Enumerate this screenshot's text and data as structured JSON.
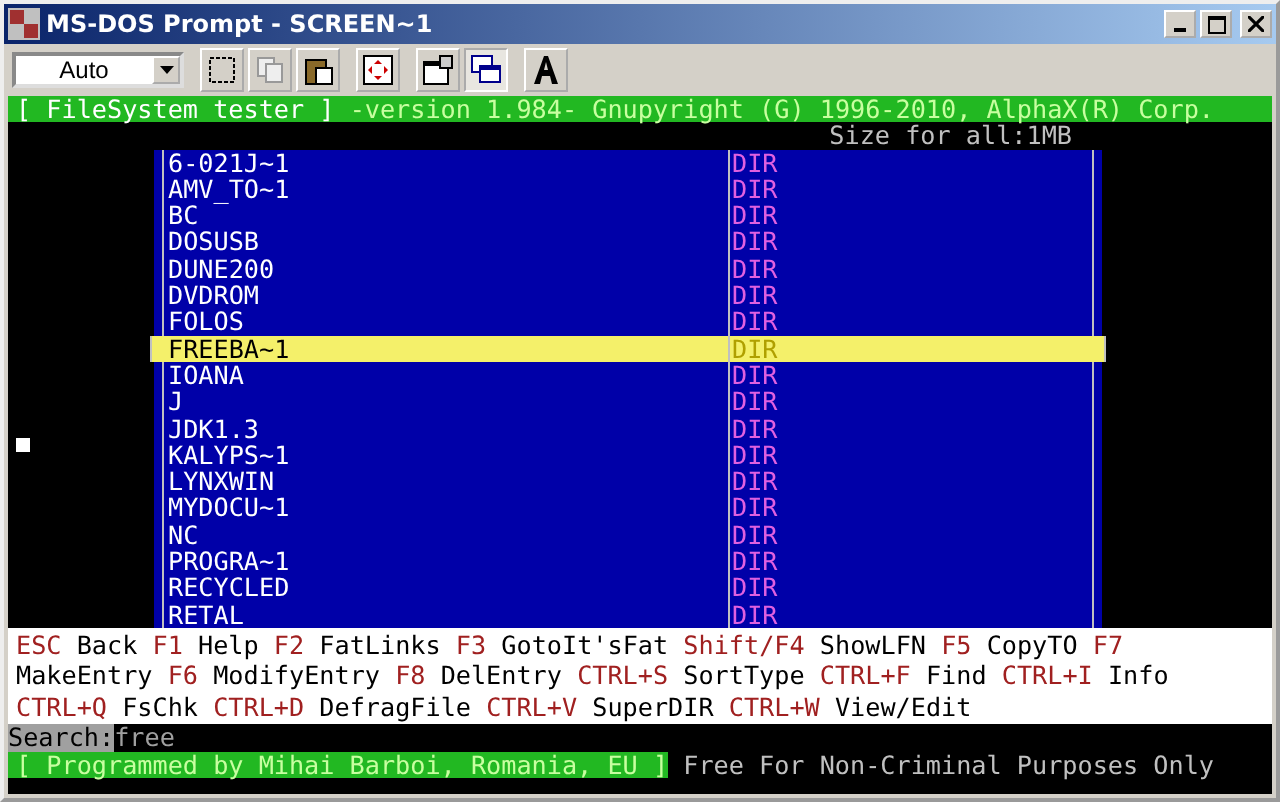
{
  "window": {
    "title": "MS-DOS Prompt - SCREEN~1"
  },
  "toolbar": {
    "font_size": "Auto"
  },
  "header": {
    "title": "[ FileSystem tester ]",
    "info": "-version 1.984- Gnupyright (G) 1996-2010, AlphaX(R) Corp.",
    "size": "Size for all:1MB"
  },
  "files": [
    {
      "name": "6-021J~1",
      "type": "DIR",
      "selected": false
    },
    {
      "name": "AMV_TO~1",
      "type": "DIR",
      "selected": false
    },
    {
      "name": "BC",
      "type": "DIR",
      "selected": false
    },
    {
      "name": "DOSUSB",
      "type": "DIR",
      "selected": false
    },
    {
      "name": "DUNE200",
      "type": "DIR",
      "selected": false
    },
    {
      "name": "DVDROM",
      "type": "DIR",
      "selected": false
    },
    {
      "name": "FOLOS",
      "type": "DIR",
      "selected": false
    },
    {
      "name": "FREEBA~1",
      "type": "DIR",
      "selected": true
    },
    {
      "name": "IOANA",
      "type": "DIR",
      "selected": false
    },
    {
      "name": "J",
      "type": "DIR",
      "selected": false
    },
    {
      "name": "JDK1.3",
      "type": "DIR",
      "selected": false
    },
    {
      "name": "KALYPS~1",
      "type": "DIR",
      "selected": false
    },
    {
      "name": "LYNXWIN",
      "type": "DIR",
      "selected": false
    },
    {
      "name": "MYDOCU~1",
      "type": "DIR",
      "selected": false
    },
    {
      "name": "NC",
      "type": "DIR",
      "selected": false
    },
    {
      "name": "PROGRA~1",
      "type": "DIR",
      "selected": false
    },
    {
      "name": "RECYCLED",
      "type": "DIR",
      "selected": false
    },
    {
      "name": "RETAL",
      "type": "DIR",
      "selected": false
    }
  ],
  "key_lines": [
    [
      {
        "kind": "key",
        "text": "ESC"
      },
      {
        "kind": "label",
        "text": "Back"
      },
      {
        "kind": "key",
        "text": "F1"
      },
      {
        "kind": "label",
        "text": "Help"
      },
      {
        "kind": "key",
        "text": "F2"
      },
      {
        "kind": "label",
        "text": "FatLinks"
      },
      {
        "kind": "key",
        "text": "F3"
      },
      {
        "kind": "label",
        "text": "GotoIt'sFat"
      },
      {
        "kind": "key",
        "text": "Shift/F4"
      },
      {
        "kind": "label",
        "text": "ShowLFN"
      },
      {
        "kind": "key",
        "text": "F5"
      },
      {
        "kind": "label",
        "text": "CopyTO"
      },
      {
        "kind": "key",
        "text": "F7"
      }
    ],
    [
      {
        "kind": "label",
        "text": "MakeEntry"
      },
      {
        "kind": "key",
        "text": "F6"
      },
      {
        "kind": "label",
        "text": "ModifyEntry"
      },
      {
        "kind": "key",
        "text": "F8"
      },
      {
        "kind": "label",
        "text": "DelEntry"
      },
      {
        "kind": "key",
        "text": "CTRL+S"
      },
      {
        "kind": "label",
        "text": "SortType"
      },
      {
        "kind": "key",
        "text": "CTRL+F"
      },
      {
        "kind": "label",
        "text": "Find"
      },
      {
        "kind": "key",
        "text": "CTRL+I"
      },
      {
        "kind": "label",
        "text": "Info"
      }
    ],
    [
      {
        "kind": "key",
        "text": "CTRL+Q"
      },
      {
        "kind": "label",
        "text": "FsChk"
      },
      {
        "kind": "key",
        "text": "CTRL+D"
      },
      {
        "kind": "label",
        "text": "DefragFile"
      },
      {
        "kind": "key",
        "text": "CTRL+V"
      },
      {
        "kind": "label",
        "text": "SuperDIR"
      },
      {
        "kind": "key",
        "text": "CTRL+W"
      },
      {
        "kind": "label",
        "text": "View/Edit"
      }
    ]
  ],
  "search": {
    "label": "Search:",
    "value": "free"
  },
  "footer": {
    "credit": "[ Programmed by Mihai Barboi, Romania, EU ]",
    "license": "Free For Non-Criminal Purposes Only"
  }
}
